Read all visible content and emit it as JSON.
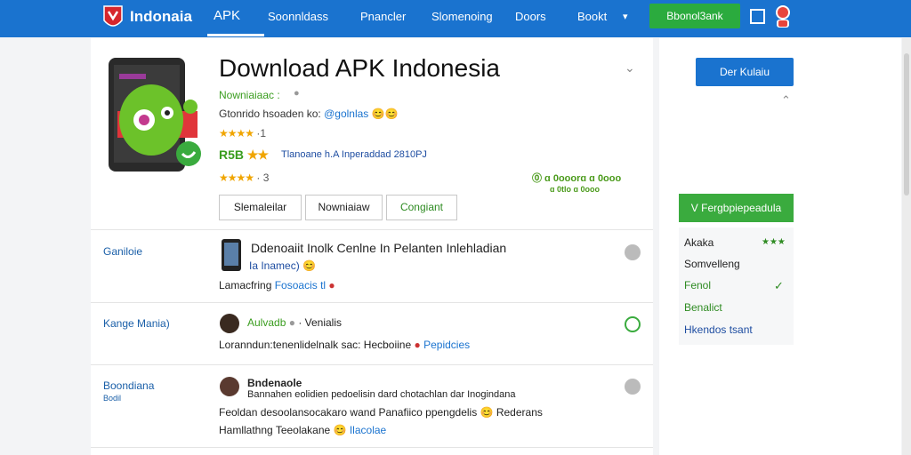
{
  "header": {
    "brand": "Indonaia",
    "nav": [
      {
        "label": "APK"
      },
      {
        "label": "Soonnldass"
      },
      {
        "label": "Pnancler"
      },
      {
        "label": "Slomenoing"
      },
      {
        "label": "Doors"
      },
      {
        "label": "Bookt"
      }
    ],
    "signin_label": "Bbonol3ank"
  },
  "app": {
    "title": "Download APK Indonesia",
    "publisher_line": "Nowniaiaac :",
    "developer_prefix": "Gtonrido hsoaden ko:",
    "developer_link": "@golnlas",
    "rating1_stars": "★★★★",
    "rating1_count": "·1",
    "size_label": "R5B",
    "size_stars": "★★",
    "size_note": "Tlanoane h.A Inperaddad 2810PJ",
    "rating2_stars": "★★★★",
    "rating2_count": "· 3",
    "badges": "⓪ ɑ 0ooorɑ ɑ 0ooo",
    "badges_sub": "ɑ 0tlo ɑ 0ooo",
    "buttons": [
      "Slemaleilar",
      "Nowniaiaw",
      "Congiant"
    ]
  },
  "rows": [
    {
      "label": "Ganiloie",
      "title": "Ddenoaiit Inolk Cenlne In Pelanten Inlehladian",
      "subtitle": "Ia Inamec)",
      "line3_prefix": "Lamacfring",
      "line3_link": "Fosoacis tl"
    },
    {
      "label": "Kange Mania)",
      "title": "Aulvadb",
      "title_suffix": "· Venialis",
      "line2_prefix": "Loranndun:tenenlidelnalk sac: Hecboiine",
      "line2_link": "Pepidcies"
    },
    {
      "label": "Boondiana",
      "sublabel": "Bodil",
      "title": "Bndenaole",
      "line2": "Bannahen eolidien pedoelisin dard chotachlan dar Inogindana",
      "line3": "Feoldan desoolansocakaro wand Panafiico ppengdelis",
      "line3_suffix": "Rederans",
      "line4_prefix": "Hamllathng  Teeolakane",
      "line4_link": "Ilacolae"
    }
  ],
  "sidebar": {
    "primary_button": "Der Kulaiu",
    "green_button": "V Fergbpiepeadula",
    "items": [
      {
        "label": "Akaka",
        "mark": "★★★"
      },
      {
        "label": "Somvelleng",
        "mark": ""
      },
      {
        "label": "Fenol",
        "mark": "✓"
      },
      {
        "label": "Benalict",
        "mark": ""
      },
      {
        "label": "Hkendos tsant",
        "mark": ""
      }
    ]
  },
  "colors": {
    "header": "#1a73cf",
    "accent_green": "#2bab3e",
    "star": "#f0a500"
  }
}
